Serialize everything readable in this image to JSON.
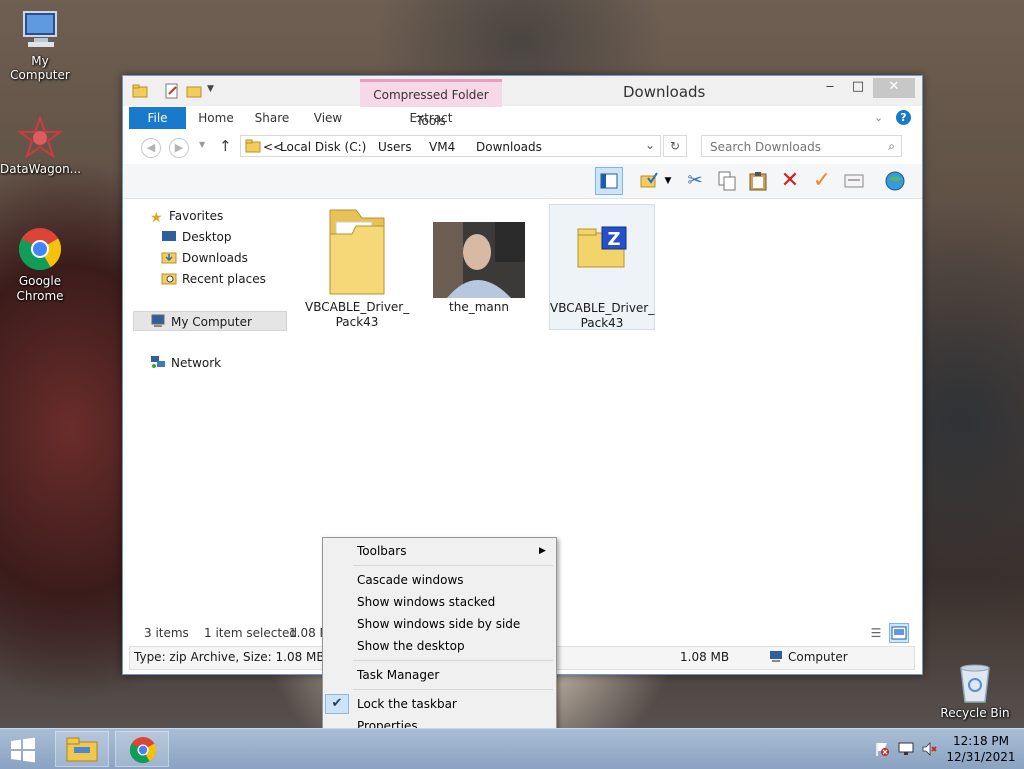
{
  "desktop": {
    "icons": [
      {
        "label": "My Computer"
      },
      {
        "label": "DataWagon..."
      },
      {
        "label": "Google Chrome"
      },
      {
        "label": "Recycle Bin"
      }
    ]
  },
  "window": {
    "title": "Downloads",
    "context_tab_group": "Compressed Folder Tools",
    "ribbon_tabs": [
      "File",
      "Home",
      "Share",
      "View",
      "Extract"
    ],
    "address": {
      "overflow": "<<",
      "breadcrumbs": [
        "Local Disk (C:)",
        "Users",
        "VM4",
        "Downloads"
      ]
    },
    "search": {
      "placeholder": "Search Downloads"
    },
    "nav": {
      "favorites": "Favorites",
      "desktop": "Desktop",
      "downloads": "Downloads",
      "recent": "Recent places",
      "my_computer": "My Computer",
      "network": "Network"
    },
    "files": [
      {
        "name": "VBCABLE_Driver_ Pack43",
        "line1": "VBCABLE_Driver_",
        "line2": "Pack43",
        "kind": "folder"
      },
      {
        "name": "the_mann",
        "line1": "the_mann",
        "line2": "",
        "kind": "image"
      },
      {
        "name": "VBCABLE_Driver_ Pack43",
        "line1": "VBCABLE_Driver_",
        "line2": "Pack43",
        "kind": "zip",
        "selected": true
      }
    ],
    "status": {
      "count": "3 items",
      "selection": "1 item selected",
      "size": "1.08 M",
      "details": "Type: zip Archive, Size: 1.08 MB, Date",
      "details_size": "1.08 MB",
      "details_location": "Computer"
    }
  },
  "context_menu": {
    "items": {
      "toolbars": "Toolbars",
      "cascade": "Cascade windows",
      "stacked": "Show windows stacked",
      "side_by_side": "Show windows side by side",
      "show_desktop": "Show the desktop",
      "task_manager": "Task Manager",
      "lock_taskbar": "Lock the taskbar",
      "properties": "Properties"
    },
    "lock_checked": true
  },
  "taskbar": {
    "time": "12:18 PM",
    "date": "12/31/2021"
  },
  "colors": {
    "accent": "#1979ca",
    "context_tab": "#f6d8e6",
    "taskbar": "#8ea9c8"
  }
}
